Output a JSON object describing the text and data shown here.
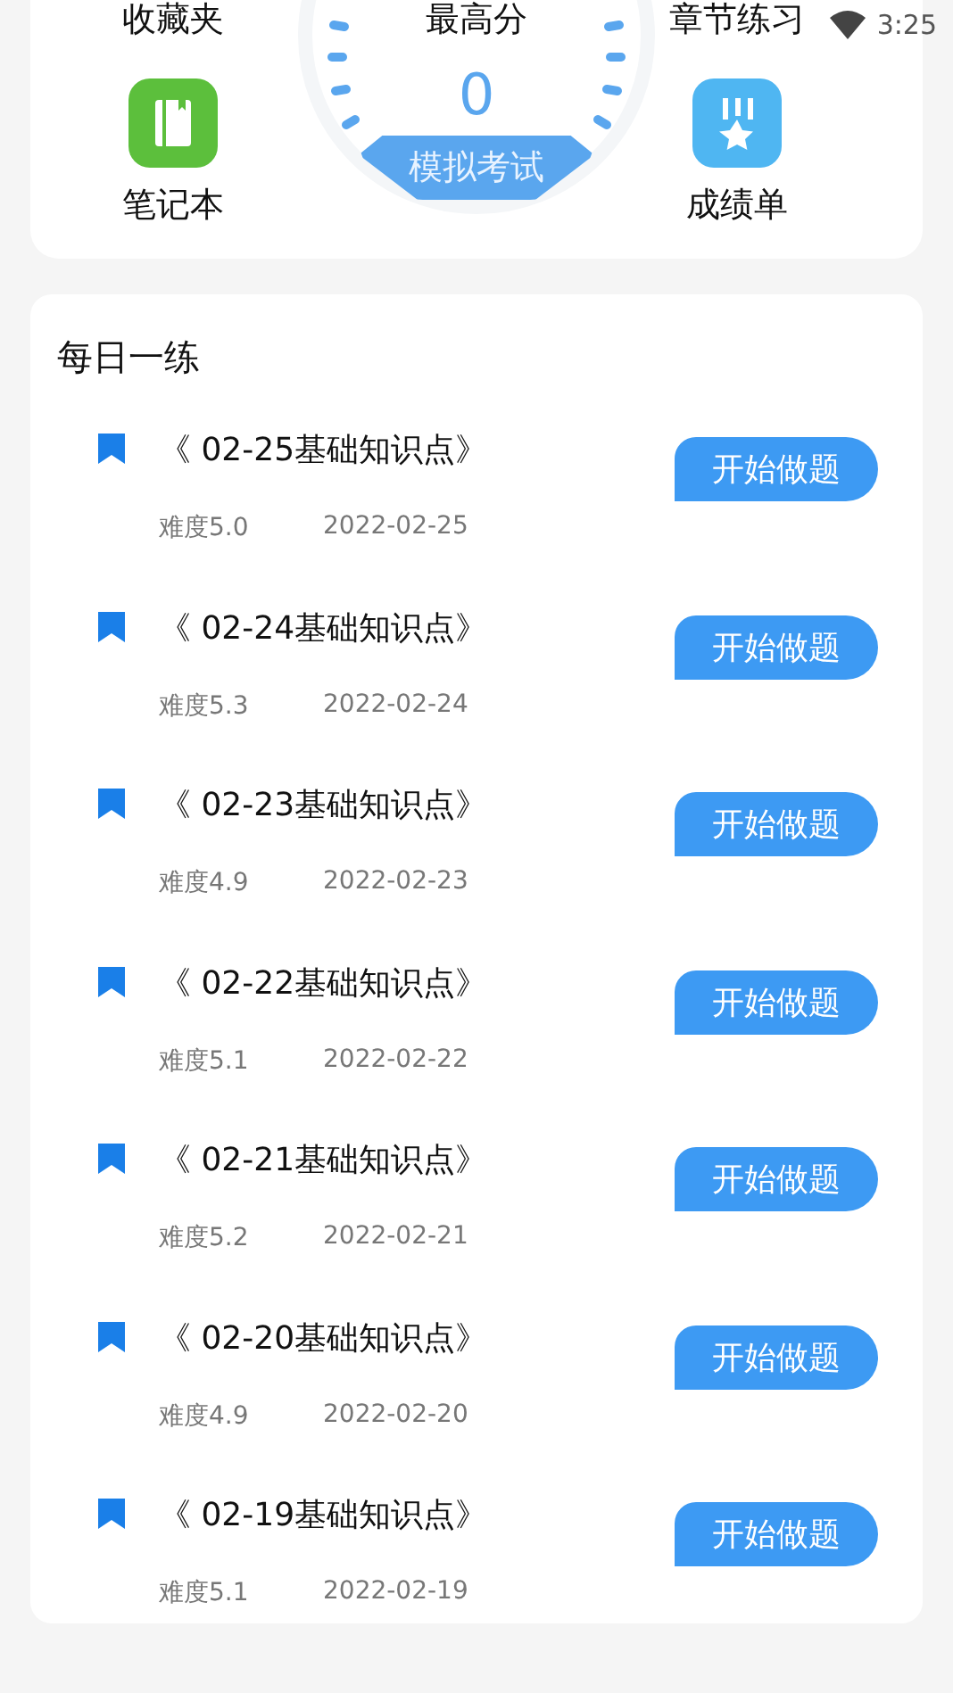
{
  "status_bar": {
    "time": "3:25"
  },
  "top_panel": {
    "left_items": [
      {
        "label": "收藏夹"
      },
      {
        "label": "笔记本",
        "kind": "notebook"
      }
    ],
    "gauge": {
      "title": "最高分",
      "score": "0",
      "button": "模拟考试"
    },
    "right_items": [
      {
        "label": "章节练习"
      },
      {
        "label": "成绩单",
        "kind": "medal"
      }
    ]
  },
  "daily_practice": {
    "title": "每日一练",
    "items": [
      {
        "title": "《 02-25基础知识点》",
        "difficulty": "难度5.0",
        "date": "2022-02-25",
        "button": "开始做题"
      },
      {
        "title": "《 02-24基础知识点》",
        "difficulty": "难度5.3",
        "date": "2022-02-24",
        "button": "开始做题"
      },
      {
        "title": "《 02-23基础知识点》",
        "difficulty": "难度4.9",
        "date": "2022-02-23",
        "button": "开始做题"
      },
      {
        "title": "《 02-22基础知识点》",
        "difficulty": "难度5.1",
        "date": "2022-02-22",
        "button": "开始做题"
      },
      {
        "title": "《 02-21基础知识点》",
        "difficulty": "难度5.2",
        "date": "2022-02-21",
        "button": "开始做题"
      },
      {
        "title": "《 02-20基础知识点》",
        "difficulty": "难度4.9",
        "date": "2022-02-20",
        "button": "开始做题"
      },
      {
        "title": "《 02-19基础知识点》",
        "difficulty": "难度5.1",
        "date": "2022-02-19",
        "button": "开始做题"
      }
    ]
  }
}
